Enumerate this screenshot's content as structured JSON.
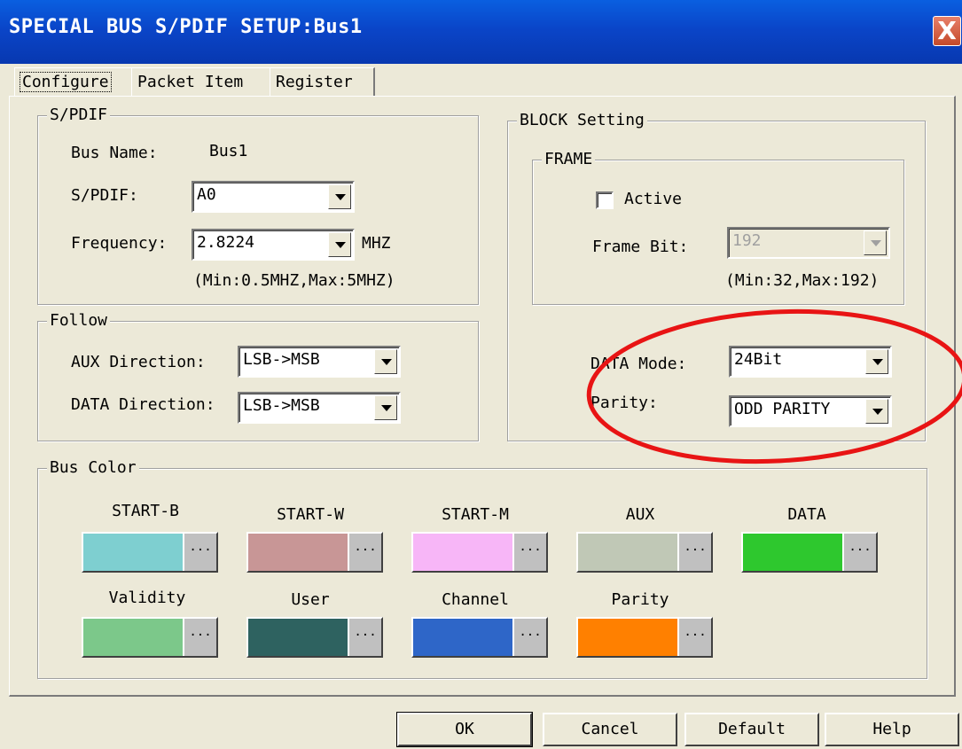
{
  "window": {
    "title": "SPECIAL BUS S/PDIF SETUP:Bus1",
    "close_glyph": "X"
  },
  "tabs": [
    {
      "label": "Configure",
      "active": true
    },
    {
      "label": "Packet Item",
      "active": false
    },
    {
      "label": "Register",
      "active": false
    }
  ],
  "spdif": {
    "legend": "S/PDIF",
    "bus_name_label": "Bus Name:",
    "bus_name_value": "Bus1",
    "spdif_label": "S/PDIF:",
    "spdif_value": "A0",
    "frequency_label": "Frequency:",
    "frequency_value": "2.8224",
    "frequency_unit": "MHZ",
    "frequency_range": "(Min:0.5MHZ,Max:5MHZ)"
  },
  "follow": {
    "legend": "Follow",
    "aux_label": "AUX Direction:",
    "aux_value": "LSB->MSB",
    "data_label": "DATA Direction:",
    "data_value": "LSB->MSB"
  },
  "block": {
    "legend": "BLOCK Setting",
    "frame_legend": "FRAME",
    "active_label": "Active",
    "active_checked": false,
    "frame_bit_label": "Frame Bit:",
    "frame_bit_value": "192",
    "frame_bit_range": "(Min:32,Max:192)",
    "data_mode_label": "DATA Mode:",
    "data_mode_value": "24Bit",
    "parity_label": "Parity:",
    "parity_value": "ODD PARITY"
  },
  "bus_color": {
    "legend": "Bus Color",
    "dots": "...",
    "items": [
      {
        "name": "START-B",
        "color": "#7ecfd0"
      },
      {
        "name": "START-W",
        "color": "#c89696"
      },
      {
        "name": "START-M",
        "color": "#f7b6f7"
      },
      {
        "name": "AUX",
        "color": "#c0c8b6"
      },
      {
        "name": "DATA",
        "color": "#2ec82e"
      },
      {
        "name": "Validity",
        "color": "#7cc88a"
      },
      {
        "name": "User",
        "color": "#2e6260"
      },
      {
        "name": "Channel",
        "color": "#2e66c8"
      },
      {
        "name": "Parity",
        "color": "#ff8000"
      }
    ]
  },
  "buttons": {
    "ok": "OK",
    "cancel": "Cancel",
    "default": "Default",
    "help": "Help"
  },
  "annotation_color": "#e81414"
}
